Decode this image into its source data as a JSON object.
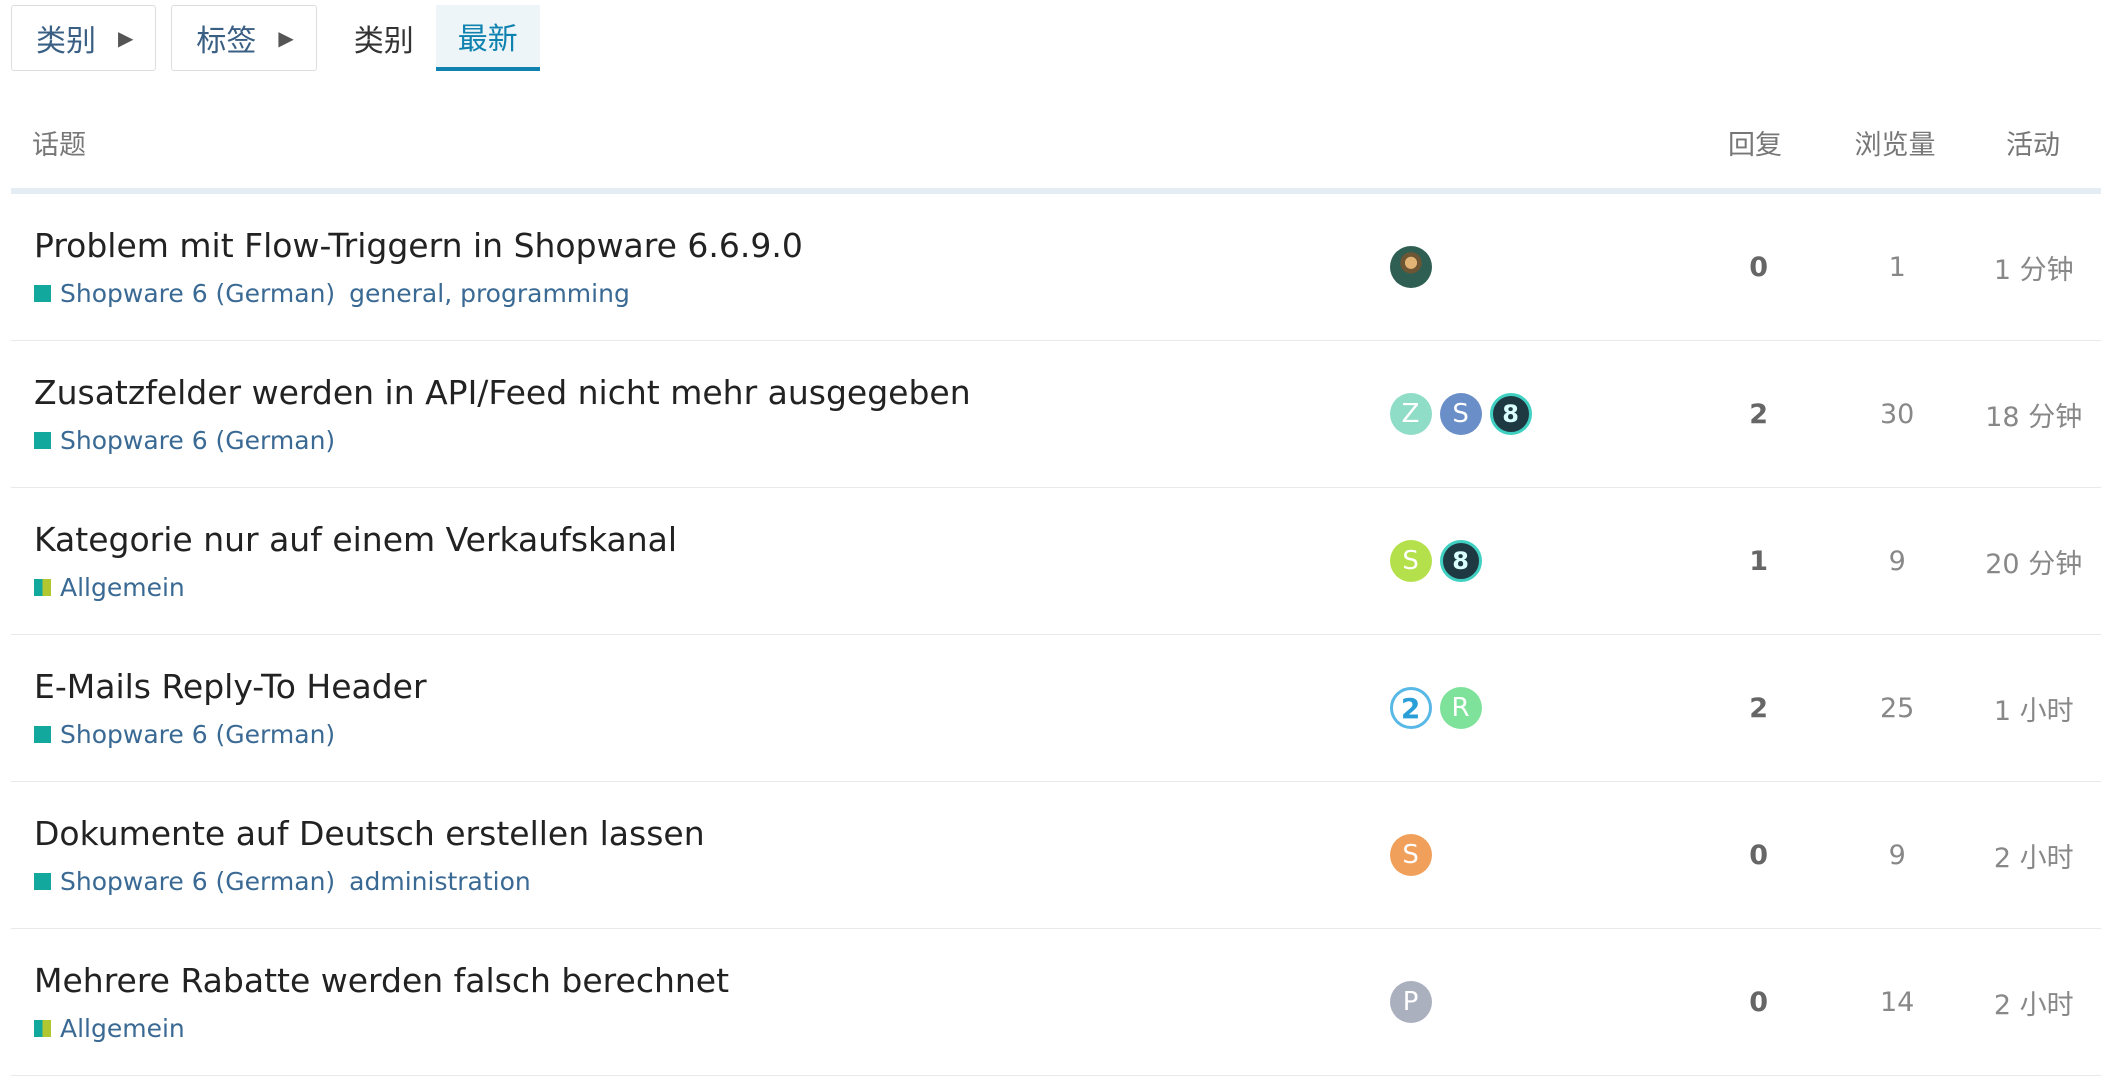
{
  "nav": {
    "categories_dropdown": "类别",
    "tags_dropdown": "标签",
    "tabs": [
      {
        "label": "类别",
        "active": false
      },
      {
        "label": "最新",
        "active": true
      }
    ]
  },
  "table": {
    "headers": {
      "topic": "话题",
      "replies": "回复",
      "views": "浏览量",
      "activity": "活动"
    },
    "topics": [
      {
        "title": "Problem mit Flow-Triggern in Shopware 6.6.9.0",
        "category": "Shopware 6 (German)",
        "tags": "general, programming",
        "avatars": [
          {
            "letter": "",
            "color": "#2e5f52",
            "style": "photo"
          }
        ],
        "replies": "0",
        "views": "1",
        "activity": "1 分钟"
      },
      {
        "title": "Zusatzfelder werden in API/Feed nicht mehr ausgegeben",
        "category": "Shopware 6 (German)",
        "tags": "",
        "avatars": [
          {
            "letter": "Z",
            "color": "#8fdcc7",
            "style": "letter"
          },
          {
            "letter": "S",
            "color": "#6a8ec8",
            "style": "letter"
          },
          {
            "letter": "8",
            "color": "#1f3943",
            "style": "dark"
          }
        ],
        "replies": "2",
        "views": "30",
        "activity": "18 分钟"
      },
      {
        "title": "Kategorie nur auf einem Verkaufskanal",
        "category": "Allgemein",
        "tags": "",
        "avatars": [
          {
            "letter": "S",
            "color": "#b4e04c",
            "style": "letter"
          },
          {
            "letter": "8",
            "color": "#1f3943",
            "style": "dark"
          }
        ],
        "replies": "1",
        "views": "9",
        "activity": "20 分钟"
      },
      {
        "title": "E-Mails Reply-To Header",
        "category": "Shopware 6 (German)",
        "tags": "",
        "avatars": [
          {
            "letter": "2",
            "color": "#ffffff",
            "style": "ring"
          },
          {
            "letter": "R",
            "color": "#7ee29a",
            "style": "letter"
          }
        ],
        "replies": "2",
        "views": "25",
        "activity": "1 小时"
      },
      {
        "title": "Dokumente auf Deutsch erstellen lassen",
        "category": "Shopware 6 (German)",
        "tags": "administration",
        "avatars": [
          {
            "letter": "S",
            "color": "#f0a05a",
            "style": "letter"
          }
        ],
        "replies": "0",
        "views": "9",
        "activity": "2 小时"
      },
      {
        "title": "Mehrere Rabatte werden falsch berechnet",
        "category": "Allgemein",
        "tags": "",
        "avatars": [
          {
            "letter": "P",
            "color": "#aab0be",
            "style": "letter"
          }
        ],
        "replies": "0",
        "views": "14",
        "activity": "2 小时"
      }
    ]
  },
  "icons": {
    "dropdown_caret": "caret-right-icon",
    "category_marker": "category-square-icon"
  },
  "colors": {
    "link": "#3a6a94",
    "active_tab": "#0f82af",
    "category_teal": "#12a89d",
    "category_lime": "#b1c731"
  }
}
